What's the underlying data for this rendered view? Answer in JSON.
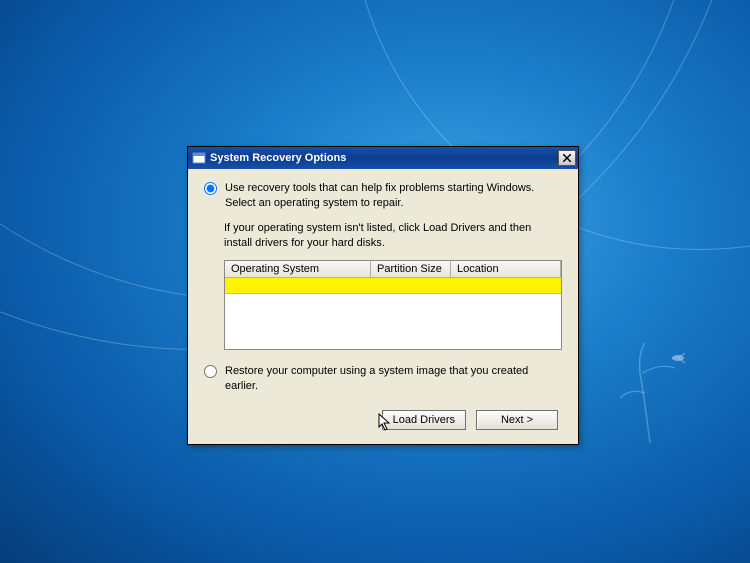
{
  "window": {
    "title": "System Recovery Options"
  },
  "option1": {
    "label": "Use recovery tools that can help fix problems starting Windows. Select an operating system to repair.",
    "hint": "If your operating system isn't listed, click Load Drivers and then install drivers for your hard disks.",
    "selected": true
  },
  "table": {
    "columns": {
      "os": "Operating System",
      "partition": "Partition Size",
      "location": "Location"
    }
  },
  "option2": {
    "label": "Restore your computer using a system image that you created earlier.",
    "selected": false
  },
  "buttons": {
    "loadDrivers": "Load Drivers",
    "next": "Next >"
  }
}
